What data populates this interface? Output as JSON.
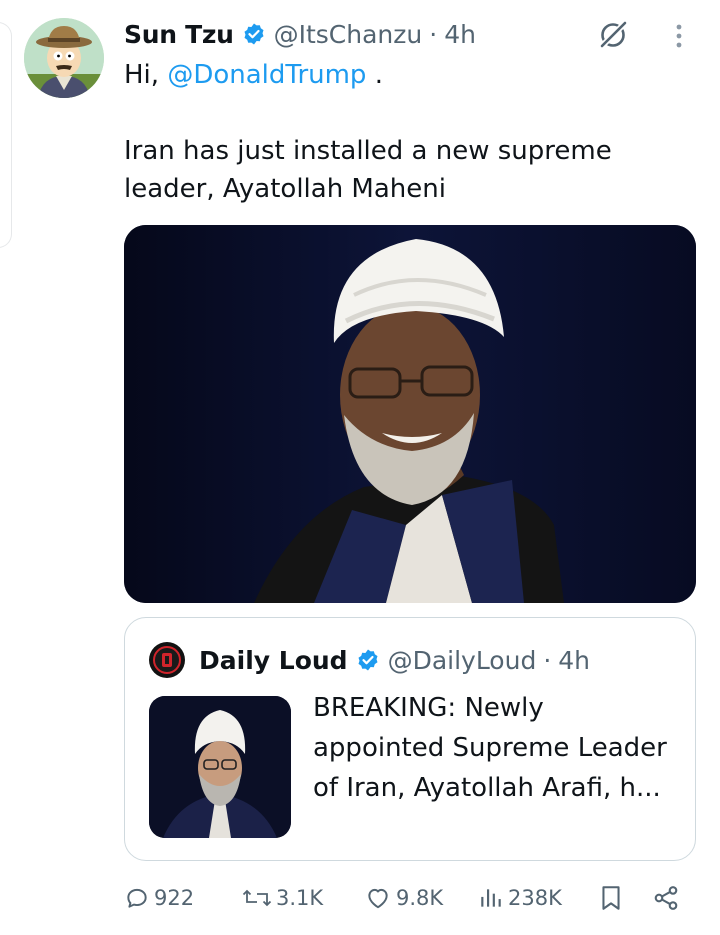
{
  "tweet": {
    "author_name": "Sun Tzu",
    "author_handle": "@ItsChanzu",
    "separator": "·",
    "time": "4h",
    "text_greeting": "Hi, ",
    "text_mention": "@DonaldTrump",
    "text_after_mention": " .",
    "text_line_1": "Iran has just installed a new supreme",
    "text_line_2": "leader, Ayatollah Maheni",
    "accent_color": "#1d9bf0",
    "icons": [
      "grok-icon",
      "more-icon",
      "verified-badge-icon"
    ]
  },
  "quote": {
    "author_name": "Daily Loud",
    "author_handle": "@DailyLoud",
    "separator": "·",
    "time": "4h",
    "text_line_1": "BREAKING: Newly",
    "text_line_2": "appointed Supreme Leader",
    "text_line_3": "of Iran, Ayatollah Arafi, h..."
  },
  "actions": {
    "replies": "922",
    "reposts": "3.1K",
    "likes": "9.8K",
    "views": "238K",
    "icons": [
      "reply-icon",
      "repost-icon",
      "like-icon",
      "views-icon",
      "bookmark-icon",
      "share-icon"
    ]
  }
}
